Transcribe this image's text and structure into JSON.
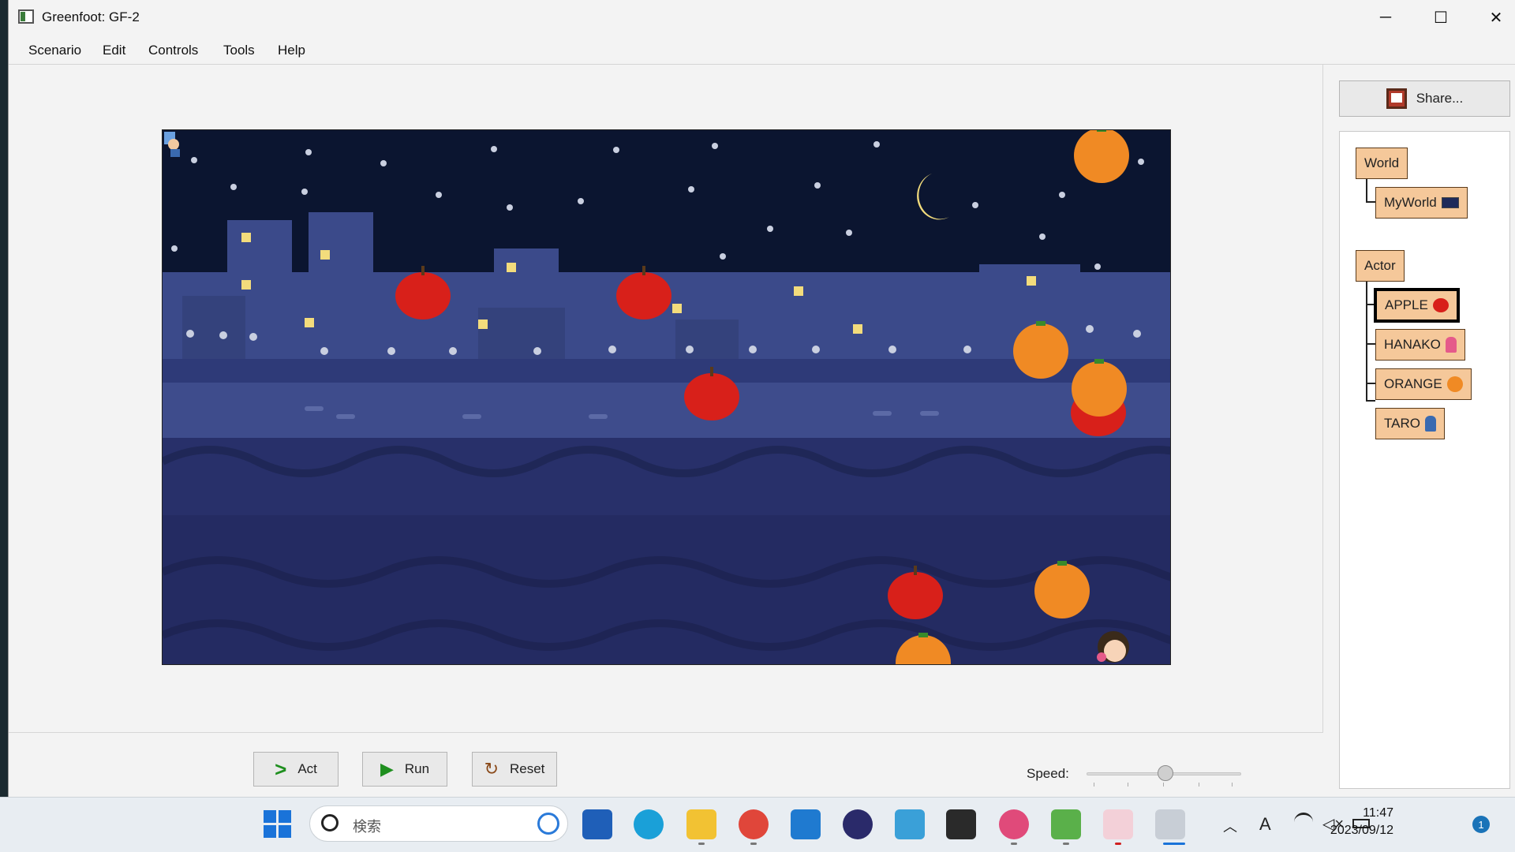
{
  "window": {
    "title": "Greenfoot: GF-2",
    "minimize": "─",
    "maximize": "☐",
    "close": "✕"
  },
  "menu": [
    "Scenario",
    "Edit",
    "Controls",
    "Tools",
    "Help"
  ],
  "controls": {
    "act": "Act",
    "run": "Run",
    "reset": "Reset",
    "speed_label": "Speed:",
    "speed_value": 0.52
  },
  "share": {
    "label": "Share..."
  },
  "classes": {
    "world": "World",
    "myworld": "MyWorld",
    "actor": "Actor",
    "subclasses": [
      "APPLE",
      "HANAKO",
      "ORANGE",
      "TARO"
    ],
    "selected": "APPLE"
  },
  "taskbar": {
    "search_placeholder": "検索",
    "time": "11:47",
    "date": "2023/09/12",
    "notification_count": "1"
  },
  "colors": {
    "sky": "#0b1530",
    "building": "#3b4a8a",
    "river": "#2a3470",
    "class_box": "#f5c89a",
    "apple": "#d8201a",
    "orange": "#f08a24"
  }
}
